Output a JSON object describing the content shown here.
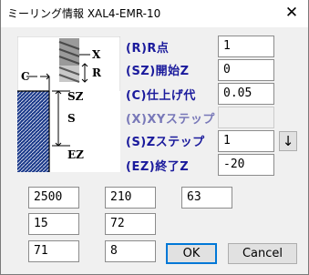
{
  "window": {
    "title": "ミーリング情報 XAL4-EMR-10",
    "close": "✕"
  },
  "diagram": {
    "c": "C",
    "x": "X",
    "r": "R",
    "sz": "SZ",
    "s": "S",
    "ez": "EZ"
  },
  "params": [
    {
      "label": "(R)R点",
      "value": "1"
    },
    {
      "label": "(SZ)開始Z",
      "value": "0"
    },
    {
      "label": "(C)仕上げ代",
      "value": "0.05"
    },
    {
      "label": "(X)XYステップ",
      "value": ""
    },
    {
      "label": "(S)Zステップ",
      "value": "1"
    },
    {
      "label": "(EZ)終了Z",
      "value": "-20"
    }
  ],
  "step_arrow": "↓",
  "grid": [
    [
      "2500",
      "210",
      "63"
    ],
    [
      "15",
      "72",
      ""
    ],
    [
      "71",
      "8",
      ""
    ]
  ],
  "buttons": {
    "ok": "OK",
    "cancel": "Cancel"
  }
}
